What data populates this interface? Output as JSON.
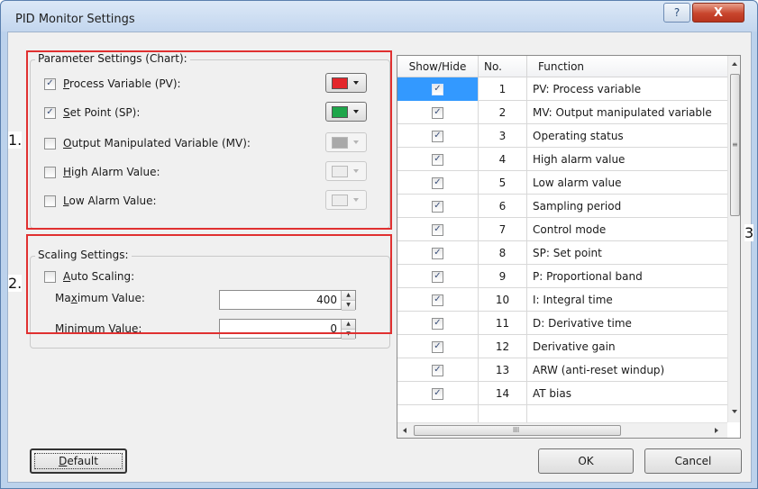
{
  "window": {
    "title": "PID Monitor Settings",
    "help_glyph": "?",
    "close_glyph": "X"
  },
  "callouts": {
    "one": "1.",
    "two": "2.",
    "three": "3"
  },
  "parameter_settings": {
    "legend": "Parameter Settings (Chart):",
    "items": [
      {
        "mnemonic": "P",
        "rest": "rocess Variable (PV):",
        "checked": true,
        "color": "#e3262b",
        "enabled": true
      },
      {
        "mnemonic": "S",
        "rest": "et Point (SP):",
        "checked": true,
        "color": "#1ea64a",
        "enabled": true
      },
      {
        "mnemonic": "O",
        "rest": "utput Manipulated Variable (MV):",
        "checked": false,
        "color": "#a9a9a9",
        "enabled": false
      },
      {
        "mnemonic": "H",
        "rest": "igh Alarm Value:",
        "checked": false,
        "color": "#ededed",
        "enabled": false
      },
      {
        "mnemonic": "L",
        "rest": "ow Alarm Value:",
        "checked": false,
        "color": "#ededed",
        "enabled": false
      }
    ]
  },
  "scaling_settings": {
    "legend": "Scaling Settings:",
    "auto_scaling": {
      "mnemonic": "A",
      "rest": "uto Scaling:",
      "checked": false
    },
    "maximum": {
      "pre": "Ma",
      "mnemonic": "x",
      "rest": "imum Value:",
      "value": "400"
    },
    "minimum": {
      "pre": "Mi",
      "mnemonic": "n",
      "rest": "imum Value:",
      "value": "0"
    }
  },
  "table": {
    "headers": [
      "Show/Hide",
      "No.",
      "Function"
    ],
    "rows": [
      {
        "show": true,
        "no": "1",
        "function": "PV: Process variable",
        "selected": true
      },
      {
        "show": true,
        "no": "2",
        "function": "MV: Output manipulated variable"
      },
      {
        "show": true,
        "no": "3",
        "function": "Operating status"
      },
      {
        "show": true,
        "no": "4",
        "function": "High alarm value"
      },
      {
        "show": true,
        "no": "5",
        "function": "Low alarm value"
      },
      {
        "show": true,
        "no": "6",
        "function": "Sampling period"
      },
      {
        "show": true,
        "no": "7",
        "function": "Control mode"
      },
      {
        "show": true,
        "no": "8",
        "function": "SP: Set point"
      },
      {
        "show": true,
        "no": "9",
        "function": "P: Proportional band"
      },
      {
        "show": true,
        "no": "10",
        "function": "I: Integral time"
      },
      {
        "show": true,
        "no": "11",
        "function": "D: Derivative time"
      },
      {
        "show": true,
        "no": "12",
        "function": "Derivative gain"
      },
      {
        "show": true,
        "no": "13",
        "function": "ARW (anti-reset windup)"
      },
      {
        "show": true,
        "no": "14",
        "function": "AT bias"
      }
    ],
    "hscroll_grip": "III",
    "vscroll_grip": "≡"
  },
  "buttons": {
    "default": {
      "mnemonic": "D",
      "rest": "efault"
    },
    "ok": "OK",
    "cancel": "Cancel"
  }
}
